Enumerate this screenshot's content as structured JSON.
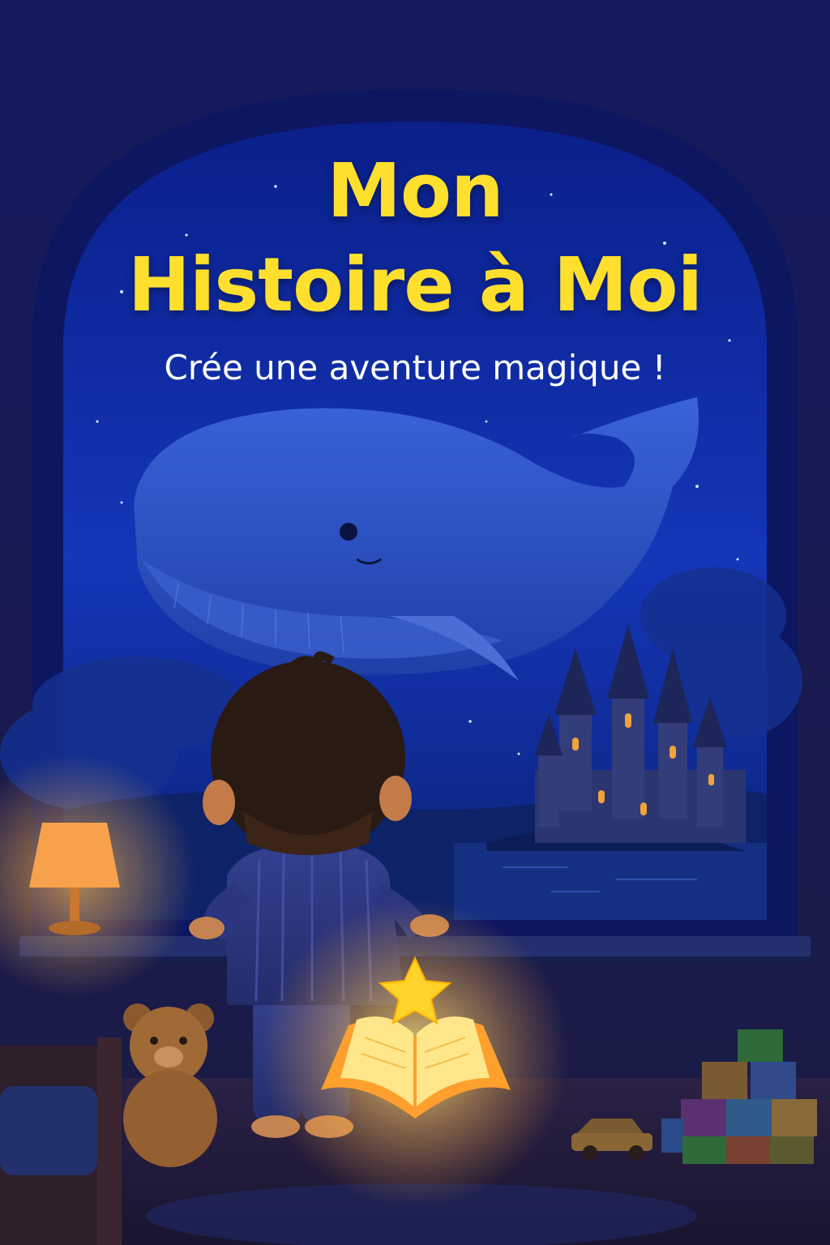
{
  "cover": {
    "title_line_1": "Mon",
    "title_line_2": "Histoire à Moi",
    "subtitle": "Crée une aventure magique !"
  },
  "colors": {
    "title": "#ffdf2e",
    "subtitle": "#ffffff",
    "night_sky": "#0f2a9a",
    "lamp_glow": "#ffb347"
  },
  "icons": [
    "whale-illustration",
    "castle-illustration",
    "boy-illustration",
    "lamp-icon",
    "teddy-bear-icon",
    "open-book-icon",
    "star-icon",
    "toy-blocks-icon",
    "toy-car-icon",
    "bed-icon"
  ]
}
